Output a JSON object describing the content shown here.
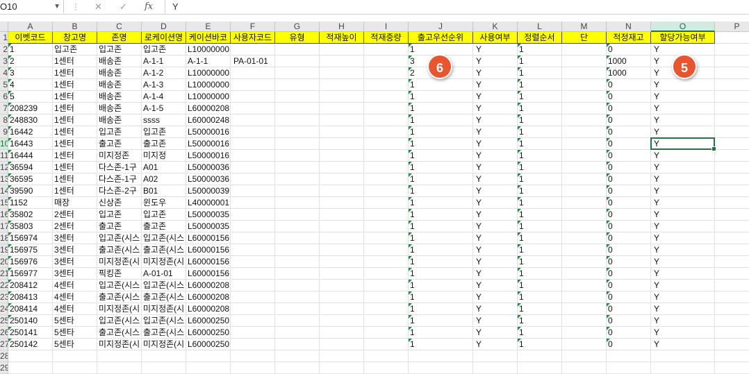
{
  "formula_bar": {
    "name_box": "O10",
    "cancel_glyph": "✕",
    "enter_glyph": "✓",
    "fx_label": "fx",
    "formula": "Y"
  },
  "columns": [
    "A",
    "B",
    "C",
    "D",
    "E",
    "F",
    "G",
    "H",
    "I",
    "J",
    "K",
    "L",
    "M",
    "N",
    "O",
    "P"
  ],
  "selected_column": "O",
  "row_numbers": [
    "1",
    "2",
    "3",
    "4",
    "5",
    "6",
    "7",
    "8",
    "9",
    "10",
    "11",
    "12",
    "13",
    "14",
    "15",
    "16",
    "17",
    "18",
    "19",
    "20",
    "21",
    "22",
    "23",
    "24",
    "25",
    "26",
    "27",
    "28",
    "29"
  ],
  "selected_row": "10",
  "header_labels": [
    "이벳코드",
    "창고명",
    "존명",
    "로케이션명",
    "케이션바코",
    "사용자코드",
    "유형",
    "적재높이",
    "적재중량",
    "출고우선순위",
    "사용여부",
    "정렬순서",
    "단",
    "적정재고",
    "할당가능여부"
  ],
  "rows": [
    [
      "1",
      "입고존",
      "입고존",
      "입고존",
      "L10000000",
      "",
      "",
      "",
      "",
      "1",
      "Y",
      "1",
      "",
      "0",
      "Y"
    ],
    [
      "2",
      "1센터",
      "배송존",
      "A-1-1",
      "A-1-1",
      "PA-01-01",
      "",
      "",
      "",
      "3",
      "Y",
      "1",
      "",
      "1000",
      "Y"
    ],
    [
      "3",
      "1센터",
      "배송존",
      "A-1-2",
      "L10000000",
      "",
      "",
      "",
      "",
      "2",
      "Y",
      "1",
      "",
      "1000",
      "Y"
    ],
    [
      "4",
      "1센터",
      "배송존",
      "A-1-3",
      "L10000000",
      "",
      "",
      "",
      "",
      "1",
      "Y",
      "1",
      "",
      "0",
      "Y"
    ],
    [
      "5",
      "1센터",
      "배송존",
      "A-1-4",
      "L10000000",
      "",
      "",
      "",
      "",
      "1",
      "Y",
      "1",
      "",
      "0",
      "Y"
    ],
    [
      "208239",
      "1센터",
      "배송존",
      "A-1-5",
      "L60000208",
      "",
      "",
      "",
      "",
      "1",
      "Y",
      "1",
      "",
      "0",
      "Y"
    ],
    [
      "248830",
      "1센터",
      "배송존",
      "ssss",
      "L60000248",
      "",
      "",
      "",
      "",
      "1",
      "Y",
      "1",
      "",
      "0",
      "Y"
    ],
    [
      "16442",
      "1센터",
      "입고존",
      "입고존",
      "L50000016",
      "",
      "",
      "",
      "",
      "1",
      "Y",
      "1",
      "",
      "0",
      "Y"
    ],
    [
      "16443",
      "1센터",
      "출고존",
      "출고존",
      "L50000016",
      "",
      "",
      "",
      "",
      "1",
      "Y",
      "1",
      "",
      "0",
      "Y"
    ],
    [
      "16444",
      "1센터",
      "미지정존",
      "미지정",
      "L50000016",
      "",
      "",
      "",
      "",
      "1",
      "Y",
      "1",
      "",
      "0",
      "Y"
    ],
    [
      "36594",
      "1센터",
      "다스존-1구",
      "A01",
      "L50000036",
      "",
      "",
      "",
      "",
      "1",
      "Y",
      "1",
      "",
      "0",
      "Y"
    ],
    [
      "36595",
      "1센터",
      "다스존-1구",
      "A02",
      "L50000036",
      "",
      "",
      "",
      "",
      "1",
      "Y",
      "1",
      "",
      "0",
      "Y"
    ],
    [
      "39590",
      "1센터",
      "다스존-2구",
      "B01",
      "L50000039",
      "",
      "",
      "",
      "",
      "1",
      "Y",
      "1",
      "",
      "0",
      "Y"
    ],
    [
      "1152",
      "매장",
      "신상존",
      "윈도우",
      "L40000001",
      "",
      "",
      "",
      "",
      "1",
      "Y",
      "1",
      "",
      "0",
      "Y"
    ],
    [
      "35802",
      "2센터",
      "입고존",
      "입고존",
      "L50000035",
      "",
      "",
      "",
      "",
      "1",
      "Y",
      "1",
      "",
      "0",
      "Y"
    ],
    [
      "35803",
      "2센터",
      "출고존",
      "출고존",
      "L50000035",
      "",
      "",
      "",
      "",
      "1",
      "Y",
      "1",
      "",
      "0",
      "Y"
    ],
    [
      "156974",
      "3센터",
      "입고존(시스",
      "입고존(시스",
      "L60000156",
      "",
      "",
      "",
      "",
      "1",
      "Y",
      "1",
      "",
      "0",
      "Y"
    ],
    [
      "156975",
      "3센터",
      "출고존(시스",
      "출고존(시스",
      "L60000156",
      "",
      "",
      "",
      "",
      "1",
      "Y",
      "1",
      "",
      "0",
      "Y"
    ],
    [
      "156976",
      "3센터",
      "미지정존(시",
      "미지정존(시",
      "L60000156",
      "",
      "",
      "",
      "",
      "1",
      "Y",
      "1",
      "",
      "0",
      "Y"
    ],
    [
      "156977",
      "3센터",
      "픽킹존",
      "A-01-01",
      "L60000156",
      "",
      "",
      "",
      "",
      "1",
      "Y",
      "1",
      "",
      "0",
      "Y"
    ],
    [
      "208412",
      "4센터",
      "입고존(시스",
      "입고존(시스",
      "L60000208",
      "",
      "",
      "",
      "",
      "1",
      "Y",
      "1",
      "",
      "0",
      "Y"
    ],
    [
      "208413",
      "4센터",
      "출고존(시스",
      "출고존(시스",
      "L60000208",
      "",
      "",
      "",
      "",
      "1",
      "Y",
      "1",
      "",
      "0",
      "Y"
    ],
    [
      "208414",
      "4센터",
      "미지정존(시",
      "미지정존(시",
      "L60000208",
      "",
      "",
      "",
      "",
      "1",
      "Y",
      "1",
      "",
      "0",
      "Y"
    ],
    [
      "250140",
      "5센타",
      "입고존(시스",
      "입고존(시스",
      "L60000250",
      "",
      "",
      "",
      "",
      "1",
      "Y",
      "1",
      "",
      "0",
      "Y"
    ],
    [
      "250141",
      "5센타",
      "출고존(시스",
      "출고존(시스",
      "L60000250",
      "",
      "",
      "",
      "",
      "1",
      "Y",
      "1",
      "",
      "0",
      "Y"
    ],
    [
      "250142",
      "5센타",
      "미지정존(시",
      "미지정존(시",
      "L60000250",
      "",
      "",
      "",
      "",
      "1",
      "Y",
      "1",
      "",
      "0",
      "Y"
    ]
  ],
  "callouts": [
    {
      "label": "6"
    },
    {
      "label": "5"
    }
  ],
  "colors": {
    "header_fill": "#ffff00",
    "selection": "#217346",
    "callout": "#e8562f",
    "error_triangle": "#1e8c3c"
  }
}
